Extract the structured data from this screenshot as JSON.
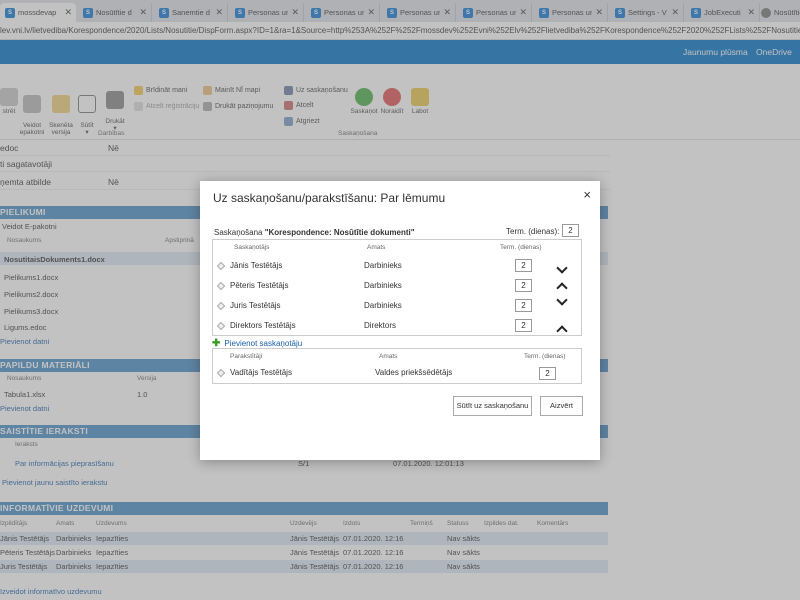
{
  "browser": {
    "tabs": [
      {
        "title": "mossdevap",
        "icon": "sharepoint-icon"
      },
      {
        "title": "Nosūtītie d",
        "icon": "sharepoint-icon"
      },
      {
        "title": "Sanemtie d",
        "icon": "sharepoint-icon"
      },
      {
        "title": "Personas un",
        "icon": "sharepoint-icon"
      },
      {
        "title": "Personas un",
        "icon": "sharepoint-icon"
      },
      {
        "title": "Personas un",
        "icon": "sharepoint-icon"
      },
      {
        "title": "Personas un",
        "icon": "sharepoint-icon"
      },
      {
        "title": "Personas un",
        "icon": "sharepoint-icon"
      },
      {
        "title": "Settings - V",
        "icon": "sharepoint-icon"
      },
      {
        "title": "JobExecuti",
        "icon": "sharepoint-icon"
      },
      {
        "title": "Nosūtītie",
        "icon": "globe-icon"
      }
    ],
    "address": "lev.vni.lv/lietvediba/Korespondence/2020/Lists/Nosutitie/DispForm.aspx?ID=1&ra=1&Source=http%253A%252F%252Fmossdev%252Evni%252Elv%252Flietvediba%252FKorespondence%252F2020%252FLists%252FNosutitieR%252FFilterTo"
  },
  "suitebar": {
    "links": [
      "Jaunumu plūsma",
      "OneDrive"
    ]
  },
  "ribbon": {
    "buttons": [
      "strēt",
      "Veidot\nepakotni",
      "Skenēta\nversija",
      "Sūtīt\n▾",
      "Drukāt\n▾"
    ],
    "small_buttons": [
      "Brīdināt mani",
      "Atcelt reģistrāciju",
      "Mainīt NĪ mapi",
      "Drukāt paziņojumu"
    ],
    "group1": "Darbības",
    "flow_small": [
      "Uz saskaņošanu",
      "Atcelt",
      "Atgriezt"
    ],
    "flow_big": [
      "Saskaņot",
      "Noraidīt",
      "Labot"
    ],
    "group2": "Saskaņošana"
  },
  "page": {
    "props": [
      {
        "k": "edoc",
        "v": "Nē"
      },
      {
        "k": "ti sagatavotāji",
        "v": ""
      },
      {
        "k": "ņemta atbilde",
        "v": "Nē"
      }
    ],
    "sections": {
      "pielikumi": "PIELIKUMI",
      "papildu": "PAPILDU MATERIĀLI",
      "saistitie": "SAISTĪTIE IERAKSTI",
      "informativie": "INFORMATĪVIE UZDEVUMI"
    },
    "pielikumi": {
      "veidot": "Veidot E-pakotni",
      "col_name": "Nosaukums",
      "col_sign": "Apstiprinā",
      "files": [
        "NosutitaisDokuments1.docx",
        "Pielikums1.docx",
        "Pielikums2.docx",
        "Pielikums3.docx",
        "Ligums.edoc"
      ],
      "add": "Pievienot datni"
    },
    "papildu": {
      "col_name": "Nosaukums",
      "col_ver": "Versija",
      "file": "Tabula1.xlsx",
      "ver": "1.0",
      "add": "Pievienot datni"
    },
    "saistitie": {
      "col_kind": "Ieraksts",
      "item": "Par informācijas pieprasīšanu",
      "num": "S/1",
      "date": "07.01.2020. 12:01:13",
      "add": "Pievienot jaunu saistīto ierakstu"
    },
    "informativie": {
      "cols": [
        "Izpildītājs",
        "Amats",
        "Uzdevums",
        "Uzdevējs",
        "Izdots",
        "Termiņš",
        "Statuss",
        "Izpildes dat.",
        "Komentārs"
      ],
      "rows": [
        {
          "who": "Jānis Testētājs",
          "role": "Darbinieks",
          "task": "Iepazīties",
          "by": "Jānis Testētājs",
          "date": "07.01.2020. 12:16",
          "status": "Nav sākts"
        },
        {
          "who": "Pēteris Testētājs",
          "role": "Darbinieks",
          "task": "Iepazīties",
          "by": "Jānis Testētājs",
          "date": "07.01.2020. 12:16",
          "status": "Nav sākts"
        },
        {
          "who": "Juris Testētājs",
          "role": "Darbinieks",
          "task": "Iepazīties",
          "by": "Jānis Testētājs",
          "date": "07.01.2020. 12:16",
          "status": "Nav sākts"
        }
      ],
      "add": "Izveidot informatīvo uzdevumu"
    }
  },
  "dialog": {
    "title": "Uz saskaņošanu/parakstīšanu: Par lēmumu",
    "close": "×",
    "flow_prefix": "Saskaņošana",
    "flow_name": "\"Korespondence: Nosūtītie dokumenti\"",
    "term_label": "Term. (dienas):",
    "term_value": "2",
    "cols": {
      "person": "Saskaņotājs",
      "role": "Amats",
      "term": "Term. (dienas)"
    },
    "approvers": [
      {
        "name": "Jānis Testētājs",
        "role": "Darbinieks",
        "term": "2"
      },
      {
        "name": "Pēteris Testētājs",
        "role": "Darbinieks",
        "term": "2"
      },
      {
        "name": "Juris Testētājs",
        "role": "Darbinieks",
        "term": "2"
      },
      {
        "name": "Direktors Testētājs",
        "role": "Direktors",
        "term": "2"
      }
    ],
    "add_approver": "Pievienot saskaņotāju",
    "signer_cols": {
      "person": "Parakstītāji",
      "role": "Amats",
      "term": "Term. (dienas)"
    },
    "signer": {
      "name": "Vadītājs Testētājs",
      "role": "Valdes priekšsēdētājs",
      "term": "2"
    },
    "submit": "Sūtīt uz saskaņošanu",
    "cancel": "Aizvērt"
  }
}
